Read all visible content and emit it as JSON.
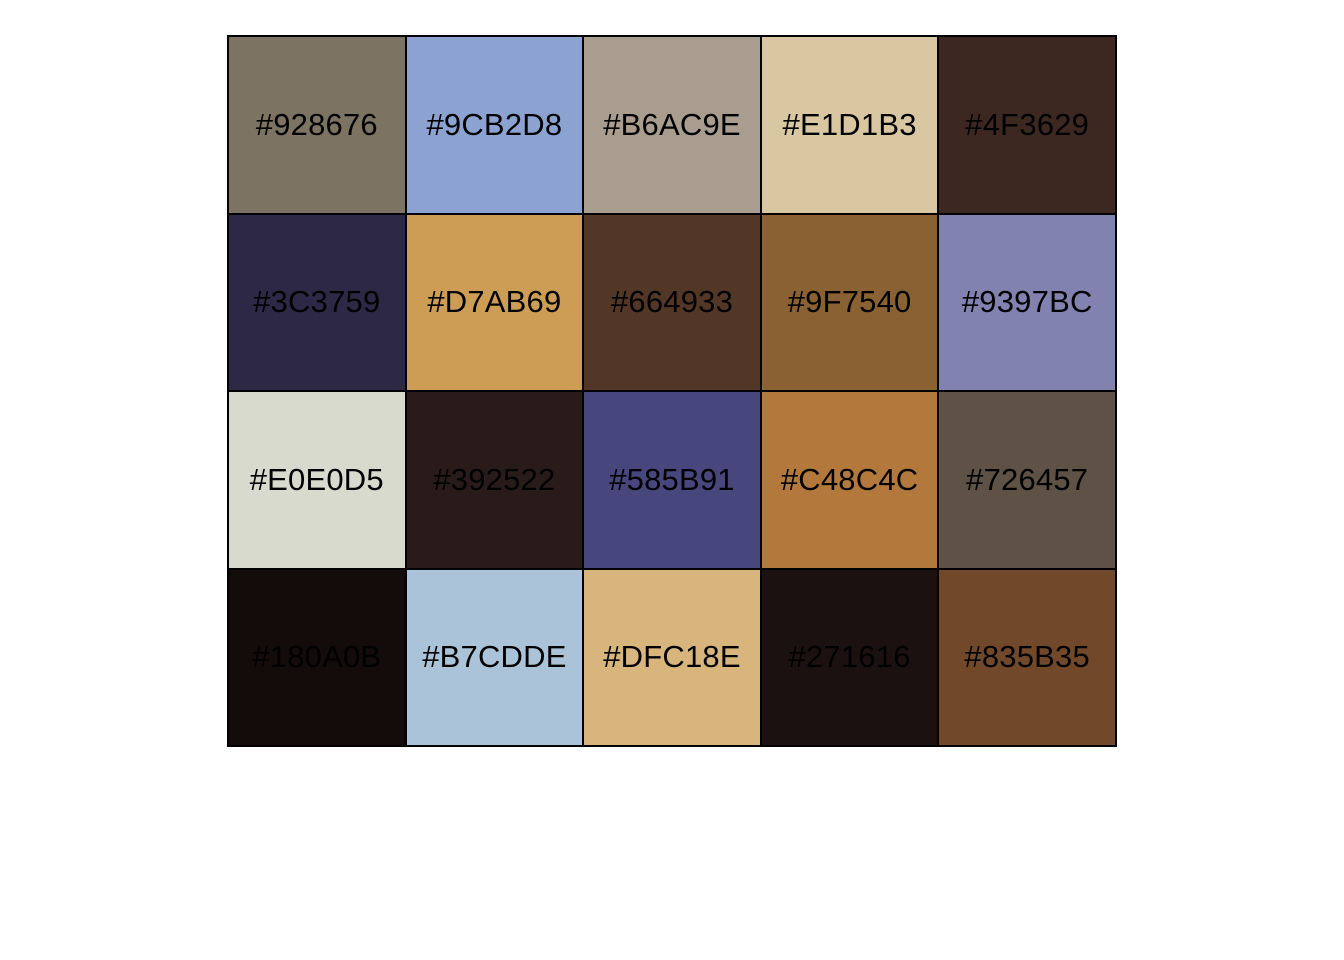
{
  "chart_data": {
    "type": "heatmap",
    "title": "",
    "rows": 4,
    "columns": 5,
    "label_color": "#000000",
    "border_color": "#000000",
    "background": "#FFFFFF",
    "cells": [
      {
        "label": "#928676",
        "color": "#7D7363"
      },
      {
        "label": "#9CB2D8",
        "color": "#8CA3D2"
      },
      {
        "label": "#B6AC9E",
        "color": "#A89D8E"
      },
      {
        "label": "#E1D1B3",
        "color": "#D9C7A2"
      },
      {
        "label": "#4F3629",
        "color": "#3C2820"
      },
      {
        "label": "#3C3759",
        "color": "#2D2845"
      },
      {
        "label": "#D7AB69",
        "color": "#CD9D56"
      },
      {
        "label": "#664933",
        "color": "#523727"
      },
      {
        "label": "#9F7540",
        "color": "#8A6132"
      },
      {
        "label": "#9397BC",
        "color": "#8182B0"
      },
      {
        "label": "#E0E0D5",
        "color": "#D9DACE"
      },
      {
        "label": "#392522",
        "color": "#2A1B1B"
      },
      {
        "label": "#585B91",
        "color": "#47467D"
      },
      {
        "label": "#C48C4C",
        "color": "#B3793C"
      },
      {
        "label": "#726457",
        "color": "#5E5145"
      },
      {
        "label": "#180A0B",
        "color": "#140B0B"
      },
      {
        "label": "#B7CDDE",
        "color": "#ABC3D8"
      },
      {
        "label": "#DFC18E",
        "color": "#D9B57E"
      },
      {
        "label": "#271616",
        "color": "#1C1111"
      },
      {
        "label": "#835B35",
        "color": "#71482A"
      }
    ]
  }
}
